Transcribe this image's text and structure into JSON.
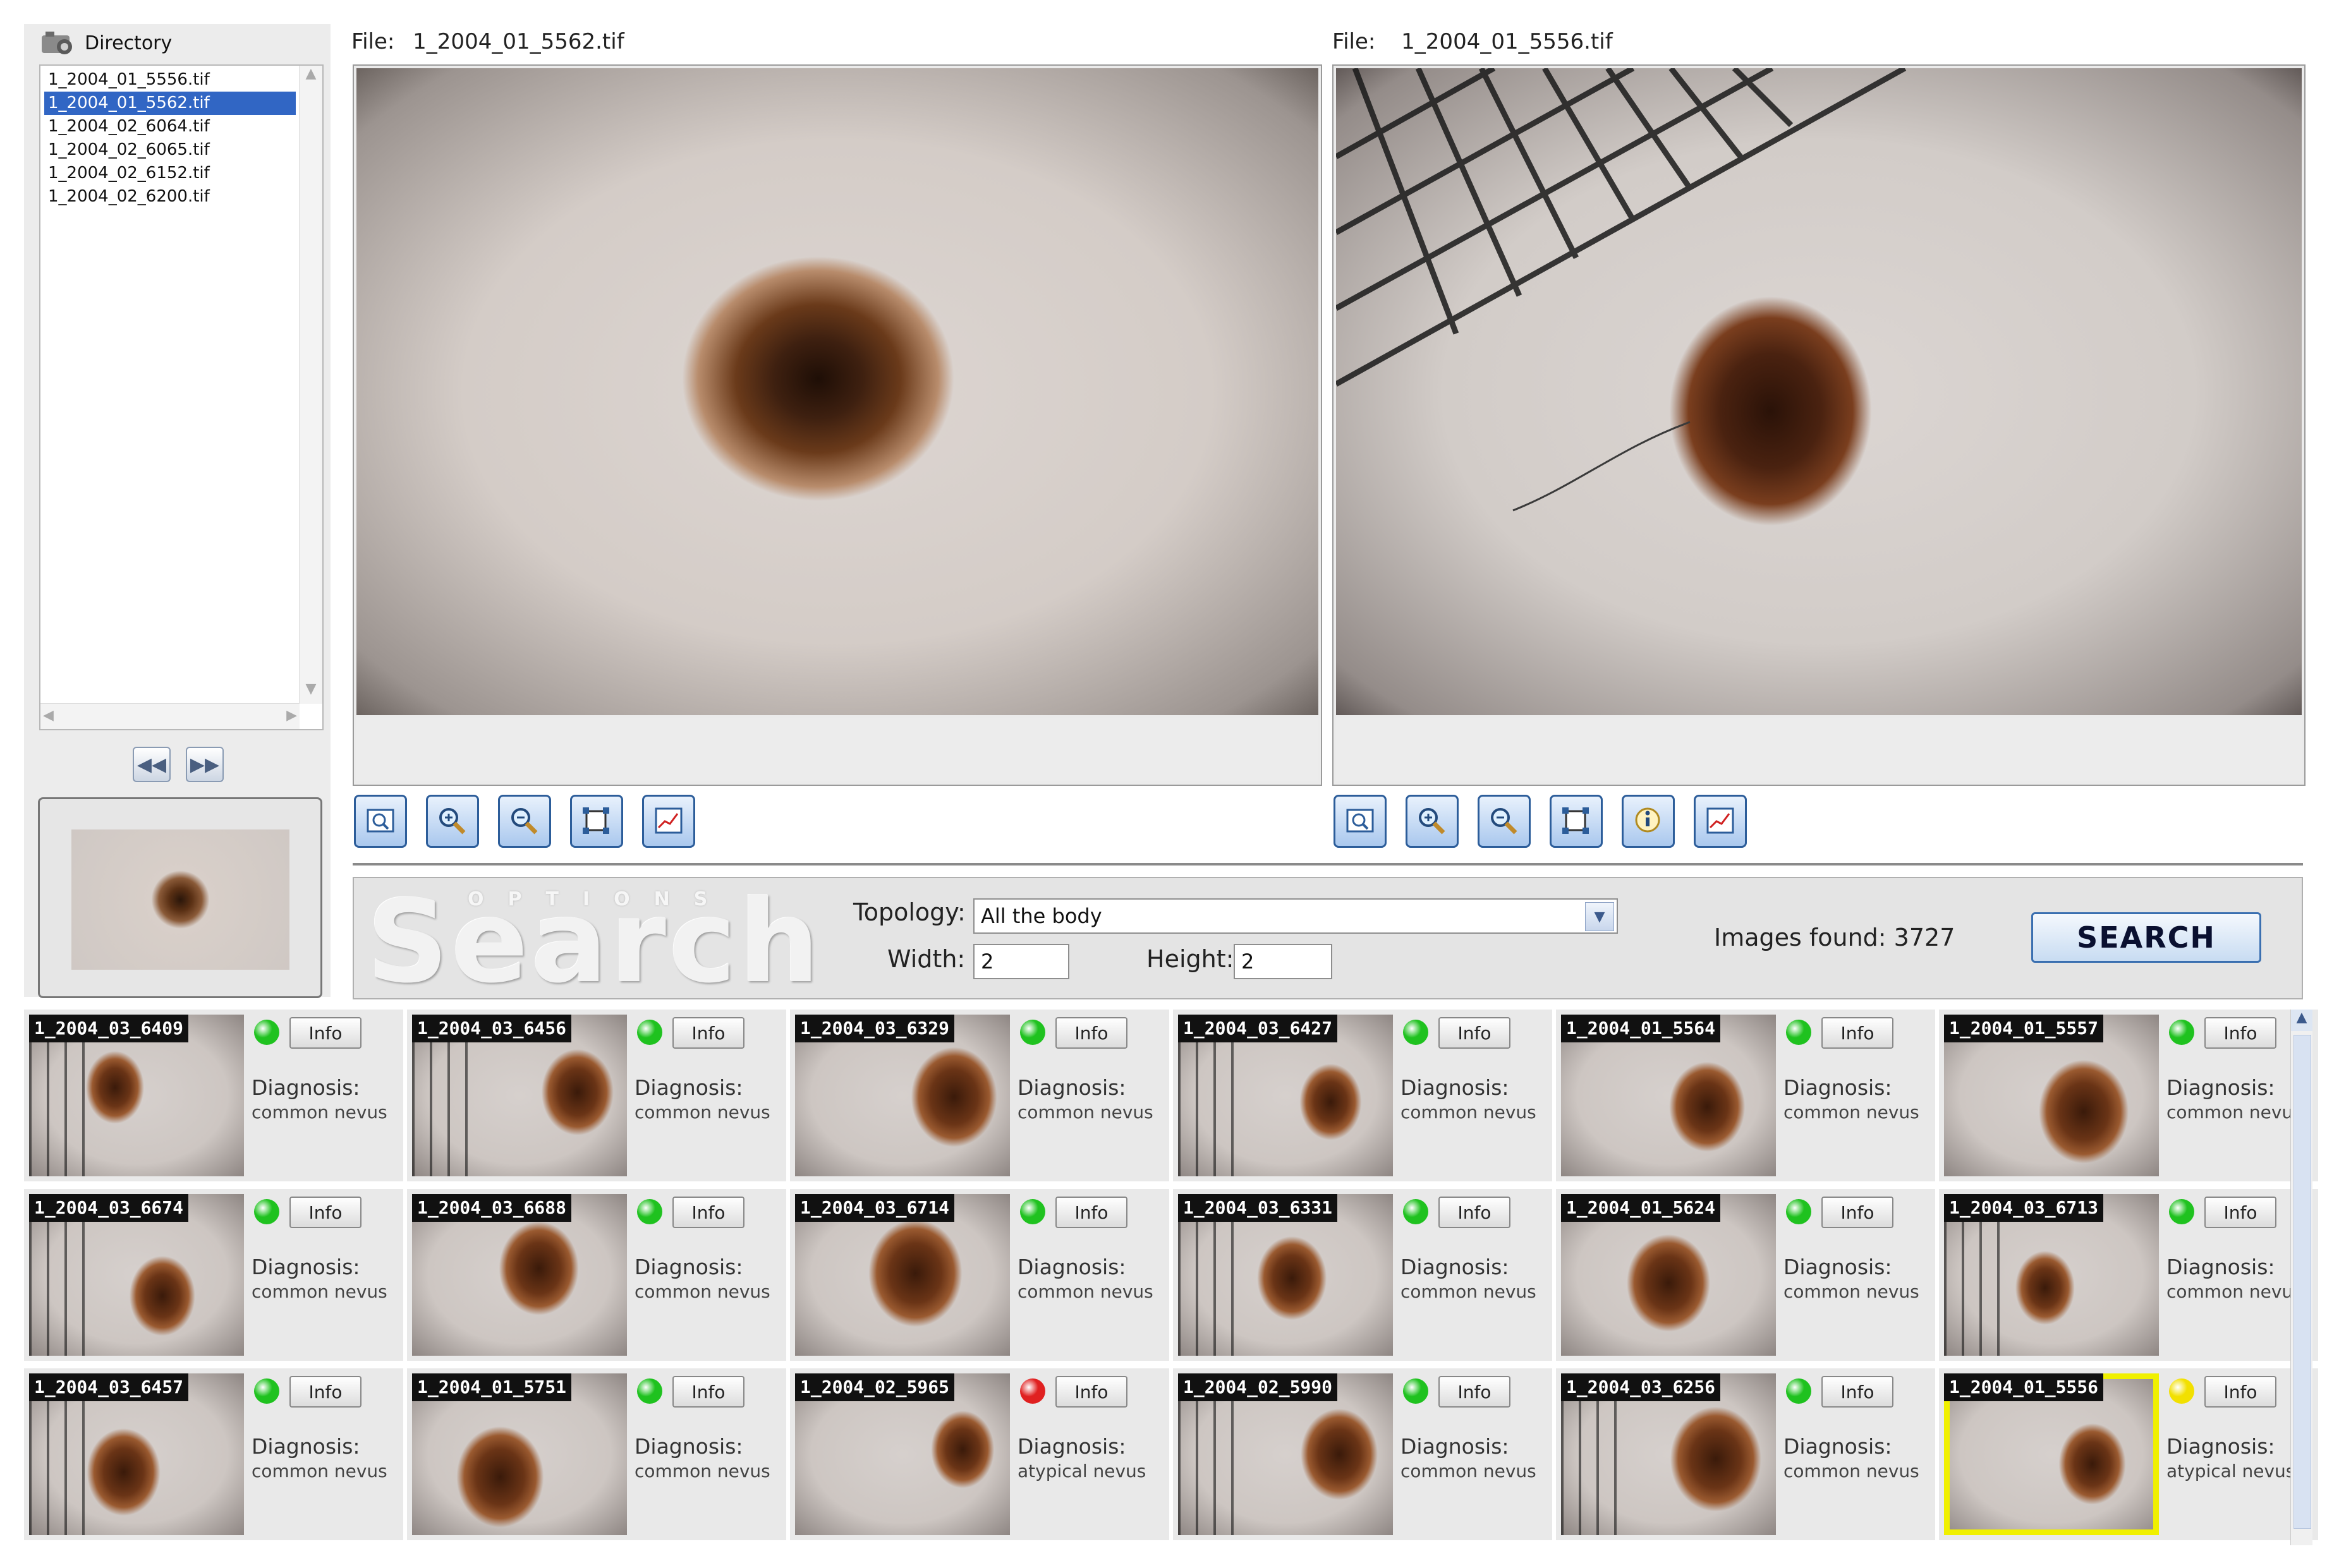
{
  "colors": {
    "accent": "#3166c4",
    "ok": "#1fc21f",
    "bad": "#e02020",
    "warn": "#f2e000",
    "highlight": "#f0f000"
  },
  "directory": {
    "title": "Directory",
    "files": [
      "1_2004_01_5556.tif",
      "1_2004_01_5562.tif",
      "1_2004_02_6064.tif",
      "1_2004_02_6065.tif",
      "1_2004_02_6152.tif",
      "1_2004_02_6200.tif"
    ],
    "selected_index": 1
  },
  "viewer_left": {
    "file_label": "File:",
    "file_name": "1_2004_01_5562.tif"
  },
  "viewer_right": {
    "file_label": "File:",
    "file_name": "1_2004_01_5556.tif"
  },
  "toolbar_left": {
    "icons": [
      "zoom-fit-icon",
      "zoom-in-icon",
      "zoom-out-icon",
      "crop-icon",
      "chart-icon"
    ]
  },
  "toolbar_right": {
    "icons": [
      "zoom-fit-icon",
      "zoom-in-icon",
      "zoom-out-icon",
      "crop-icon",
      "info-icon",
      "chart-icon"
    ]
  },
  "search": {
    "logo_small": "OPTIONS",
    "logo_big": "Search",
    "topology_label": "Topology:",
    "topology_value": "All the body",
    "width_label": "Width:",
    "width_value": "2",
    "height_label": "Height:",
    "height_value": "2",
    "images_found": "Images found: 3727",
    "button": "SEARCH"
  },
  "results": {
    "info_label": "Info",
    "diagnosis_label": "Diagnosis:",
    "items": [
      {
        "name": "1_2004_03_6409",
        "status": "ok",
        "diagnosis": "common nevus"
      },
      {
        "name": "1_2004_03_6456",
        "status": "ok",
        "diagnosis": "common nevus"
      },
      {
        "name": "1_2004_03_6329",
        "status": "ok",
        "diagnosis": "common nevus"
      },
      {
        "name": "1_2004_03_6427",
        "status": "ok",
        "diagnosis": "common nevus"
      },
      {
        "name": "1_2004_01_5564",
        "status": "ok",
        "diagnosis": "common nevus"
      },
      {
        "name": "1_2004_01_5557",
        "status": "ok",
        "diagnosis": "common nevu"
      },
      {
        "name": "1_2004_03_6674",
        "status": "ok",
        "diagnosis": "common nevus"
      },
      {
        "name": "1_2004_03_6688",
        "status": "ok",
        "diagnosis": "common nevus"
      },
      {
        "name": "1_2004_03_6714",
        "status": "ok",
        "diagnosis": "common nevus"
      },
      {
        "name": "1_2004_03_6331",
        "status": "ok",
        "diagnosis": "common nevus"
      },
      {
        "name": "1_2004_01_5624",
        "status": "ok",
        "diagnosis": "common nevus"
      },
      {
        "name": "1_2004_03_6713",
        "status": "ok",
        "diagnosis": "common nevu"
      },
      {
        "name": "1_2004_03_6457",
        "status": "ok",
        "diagnosis": "common nevus"
      },
      {
        "name": "1_2004_01_5751",
        "status": "ok",
        "diagnosis": "common nevus"
      },
      {
        "name": "1_2004_02_5965",
        "status": "bad",
        "diagnosis": "atypical nevus"
      },
      {
        "name": "1_2004_02_5990",
        "status": "ok",
        "diagnosis": "common nevus"
      },
      {
        "name": "1_2004_03_6256",
        "status": "ok",
        "diagnosis": "common nevus"
      },
      {
        "name": "1_2004_01_5556",
        "status": "warn",
        "diagnosis": "atypical nevus",
        "highlighted": true
      }
    ]
  }
}
